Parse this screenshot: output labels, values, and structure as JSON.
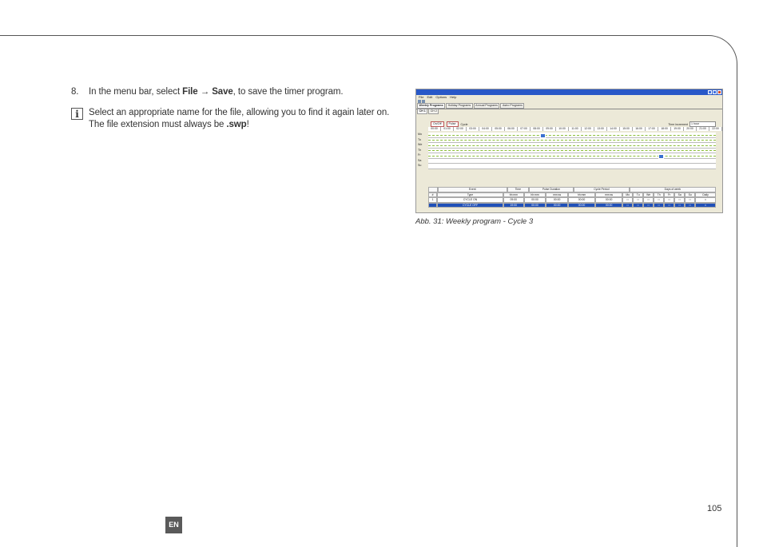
{
  "instruction": {
    "number": "8.",
    "prefix": "In the menu bar, select ",
    "file": "File",
    "arrow": "→",
    "save": "Save",
    "suffix": ", to save the timer program."
  },
  "note": {
    "icon": "i",
    "line1": "Select an appropriate name for the file, allowing you to find it again later on.",
    "line2_prefix": "The file extension must always be ",
    "extension": ".swp",
    "line2_suffix": "!"
  },
  "figure": {
    "caption": "Abb. 31:  Weekly program - Cycle 3",
    "menu": [
      "File",
      "Edit",
      "Options",
      "Help"
    ],
    "tabs": [
      "Weekly Programs",
      "Holiday Programs",
      "Annual Programs",
      "Astro Programs"
    ],
    "channel_tabs": [
      "CH 1",
      "CH 2"
    ],
    "controls": {
      "onoff": "On/Off",
      "pulse": "Pulse",
      "cycle": "Cycle"
    },
    "time_increment_label": "Time increment",
    "time_increment_value": "1 hour",
    "hours": [
      "00:00",
      "01:00",
      "02:00",
      "03:00",
      "04:00",
      "05:00",
      "06:00",
      "07:00",
      "08:00",
      "09:00",
      "10:00",
      "11:00",
      "12:00",
      "13:00",
      "14:00",
      "15:00",
      "16:00",
      "17:00",
      "18:00",
      "19:00",
      "20:00",
      "21:00",
      "22:00",
      "23:00"
    ],
    "days": [
      "Mo",
      "Tu",
      "We",
      "Th",
      "Fr",
      "Sa",
      "Su"
    ],
    "table_headers_1": [
      "",
      "Event",
      "Time",
      "Pulse Duration",
      "Cycle Period",
      "Days of week"
    ],
    "table_headers_2": [
      "#",
      "Type",
      "hh:mm",
      "hh:mm",
      "mm:ss",
      "hh:mm",
      "mm:ss",
      "Mo",
      "Tu",
      "We",
      "Th",
      "Fr",
      "Sa",
      "Su",
      "Daily"
    ],
    "rows": [
      [
        "1",
        "CYCLE ON",
        "09:00",
        "00:00",
        "00:00",
        "00:00",
        "00:00"
      ],
      [
        "",
        "CYCLE OFF",
        "19:00",
        "00:00",
        "00:00",
        "00:00",
        "00:00"
      ]
    ]
  },
  "page_number": "105",
  "language": "EN"
}
